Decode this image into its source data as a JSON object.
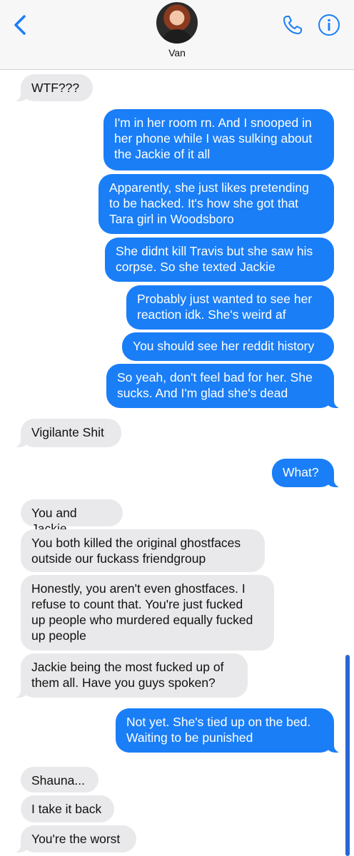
{
  "header": {
    "contact_name": "Van",
    "back_icon": "chevron-left-icon",
    "call_icon": "phone-icon",
    "info_icon": "info-icon",
    "accent_color": "#1a7ef7"
  },
  "messages": [
    {
      "from": "them",
      "text": "WTF???"
    },
    {
      "from": "me",
      "text": "I'm in her room rn. And I snooped in\nher phone while I was sulking about\nthe Jackie of it all"
    },
    {
      "from": "me",
      "text": "Apparently, she just likes pretending\nto be hacked. It's how she got that\nTara girl in Woodsboro"
    },
    {
      "from": "me",
      "text": "She didnt kill Travis but she saw his\ncorpse. So she texted Jackie"
    },
    {
      "from": "me",
      "text": "Probably just wanted to see her\nreaction idk. She's weird af"
    },
    {
      "from": "me",
      "text": "You should see her reddit history"
    },
    {
      "from": "me",
      "text": "So yeah, don't feel bad for her. She\nsucks. And I'm glad she's dead"
    },
    {
      "from": "them",
      "text": "Vigilante Shit"
    },
    {
      "from": "me",
      "text": "What?"
    },
    {
      "from": "them",
      "text": "You and Jackie"
    },
    {
      "from": "them",
      "text": "You both killed the original ghostfaces\noutside our fuckass friendgroup"
    },
    {
      "from": "them",
      "text": "Honestly, you aren't even ghostfaces. I\nrefuse to count that. You're just fucked\nup people who murdered equally fucked\nup people"
    },
    {
      "from": "them",
      "text": "Jackie being the most fucked up of\nthem all. Have you guys spoken?"
    },
    {
      "from": "me",
      "text": "Not yet. She's tied up on the bed.\nWaiting to be punished"
    },
    {
      "from": "them",
      "text": "Shauna..."
    },
    {
      "from": "them",
      "text": "I take it back"
    },
    {
      "from": "them",
      "text": "You're the worst"
    }
  ]
}
